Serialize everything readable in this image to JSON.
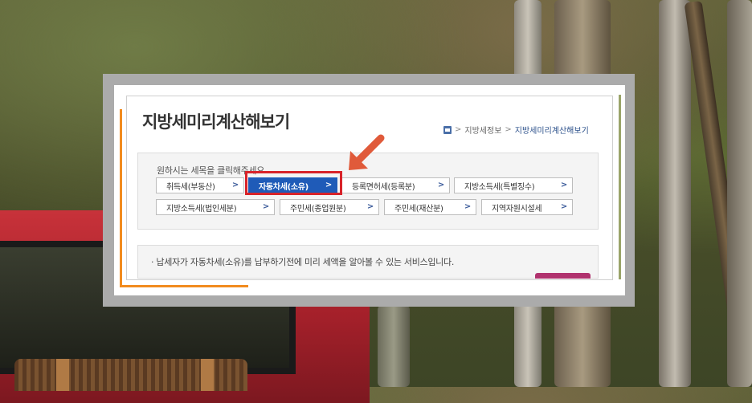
{
  "page": {
    "title": "지방세미리계산해보기"
  },
  "breadcrumb": {
    "home_icon": "home-icon",
    "separator": ">",
    "items": [
      "지방세정보",
      "지방세미리계산해보기"
    ]
  },
  "tax_selector": {
    "instruction": "원하시는 세목을 클릭해주세요",
    "chevron": ">",
    "selected_index": 1,
    "buttons": [
      {
        "label": "취득세(부동산)"
      },
      {
        "label": "자동차세(소유)"
      },
      {
        "label": "등록면허세(등록분)"
      },
      {
        "label": "지방소득세(특별징수)"
      },
      {
        "label": "지방소득세(법인세분)"
      },
      {
        "label": "주민세(종업원분)"
      },
      {
        "label": "주민세(재산분)"
      },
      {
        "label": "지역자원시설세"
      }
    ]
  },
  "info": {
    "text": "· 납세자가 자동차세(소유)를 납부하기전에 미리 세액을 알아볼 수 있는 서비스입니다."
  },
  "colors": {
    "active_button": "#1f5bb8",
    "highlight_border": "#d8232a",
    "pointer_arrow": "#e05a3a",
    "orange_accent": "#f28b1e"
  }
}
